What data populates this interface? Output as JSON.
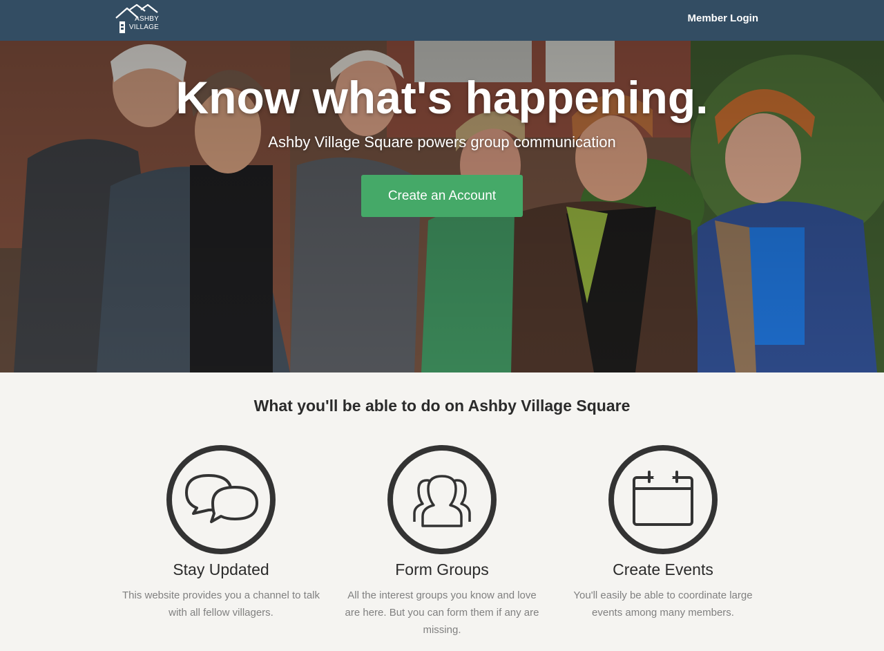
{
  "nav": {
    "logo_line1": "ASHBY",
    "logo_line2": "VILLAGE",
    "member_login": "Member Login"
  },
  "hero": {
    "title": "Know what's happening.",
    "subtitle": "Ashby Village Square powers group communication",
    "cta_label": "Create an Account",
    "cta_color": "#45a968"
  },
  "features": {
    "title": "What you'll be able to do on Ashby Village Square",
    "items": [
      {
        "icon": "chat-bubbles-icon",
        "title": "Stay Updated",
        "text": "This website provides you a channel to talk with all fellow villagers."
      },
      {
        "icon": "group-icon",
        "title": "Form Groups",
        "text": "All the interest groups you know and love are here. But you can form them if any are missing."
      },
      {
        "icon": "calendar-icon",
        "title": "Create Events",
        "text": "You'll easily be able to coordinate large events among many members."
      }
    ]
  },
  "colors": {
    "navbar": "#334d63",
    "page_bg": "#f5f4f1",
    "icon_stroke": "#333333"
  }
}
